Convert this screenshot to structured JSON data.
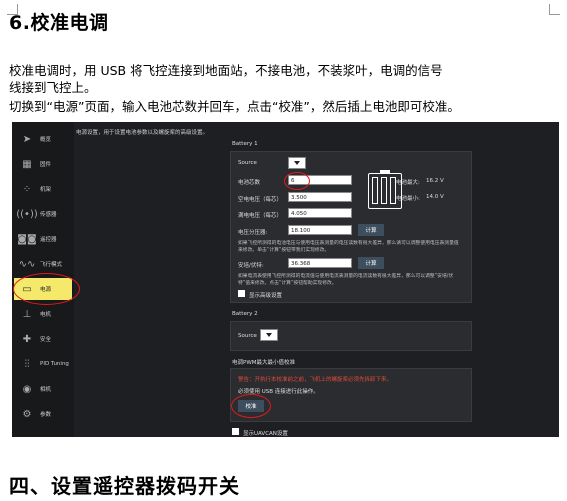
{
  "heading": "6.校准电调",
  "paragraph": {
    "line1": "校准电调时，用 USB 将飞控连接到地面站，不接电池，不装浆叶，电调的信号",
    "line2": "线接到飞控上。",
    "line3": "切换到“电源”页面，输入电池芯数并回车，点击“校准”，然后插上电池即可校准。"
  },
  "screenshot": {
    "top_note": "电源设置，用于设置电池参数以及螺旋桨的高级设置。",
    "sidebar": [
      {
        "label": "概览",
        "icon": "paper-plane-icon"
      },
      {
        "label": "固件",
        "icon": "chip-icon"
      },
      {
        "label": "机架",
        "icon": "airframe-icon"
      },
      {
        "label": "传感器",
        "icon": "radio-waves-icon"
      },
      {
        "label": "遥控器",
        "icon": "radio-controller-icon"
      },
      {
        "label": "飞行模式",
        "icon": "waveform-icon"
      },
      {
        "label": "电源",
        "icon": "battery-icon"
      },
      {
        "label": "电机",
        "icon": "motor-icon"
      },
      {
        "label": "安全",
        "icon": "safety-cross-icon"
      },
      {
        "label": "PID Tuning",
        "icon": "sliders-icon"
      },
      {
        "label": "相机",
        "icon": "camera-icon"
      },
      {
        "label": "参数",
        "icon": "gears-icon"
      }
    ],
    "battery1": {
      "title": "Battery 1",
      "source_label": "Source",
      "cells_label": "电池芯数",
      "cells_value": "6",
      "max_label": "电池最大:",
      "max_value": "16.2 V",
      "min_label": "电池最小:",
      "min_value": "14.0 V",
      "full_label": "空电电压（每芯）",
      "full_value": "3.500",
      "empty_label": "满电电压（每芯）",
      "empty_value": "4.050",
      "divider_label": "电压分压器:",
      "divider_value": "18.100",
      "calc_button": "计算",
      "divider_note": "如果飞控所测得的电池电压与使用电压表测量的电压读数有很大差异，那么请可以调整使用电压表测量值来修改。单击“计算”按钮带我们实现修改。",
      "amps_label": "安培/伏特:",
      "amps_value": "36.368",
      "amps_note": "如果电流表使用飞控所测得的电流值与使用电流表测量的电流读数有很大差异，那么可以调整“安培/伏特”值来修改。点击“计算”按钮帮助实现修改。",
      "advanced_label": "显示高级设置"
    },
    "battery2": {
      "title": "Battery 2",
      "source_label": "Source"
    },
    "esc": {
      "title": "电调PWM最大最小值校准",
      "warning": "警告：开执行本校准前之前，飞机上的螺旋桨必须先拆卸下来。",
      "usb_note": "必须使用 USB 连接进行此操作。",
      "calibrate_button": "校准"
    },
    "uavcan_label": "显示UAVCAN设置"
  },
  "heading2": "四、设置遥控器拨码开关",
  "colors": {
    "highlight": "#f5e96b",
    "annotation_red": "#e21a1a",
    "warning": "#e04b3a"
  }
}
